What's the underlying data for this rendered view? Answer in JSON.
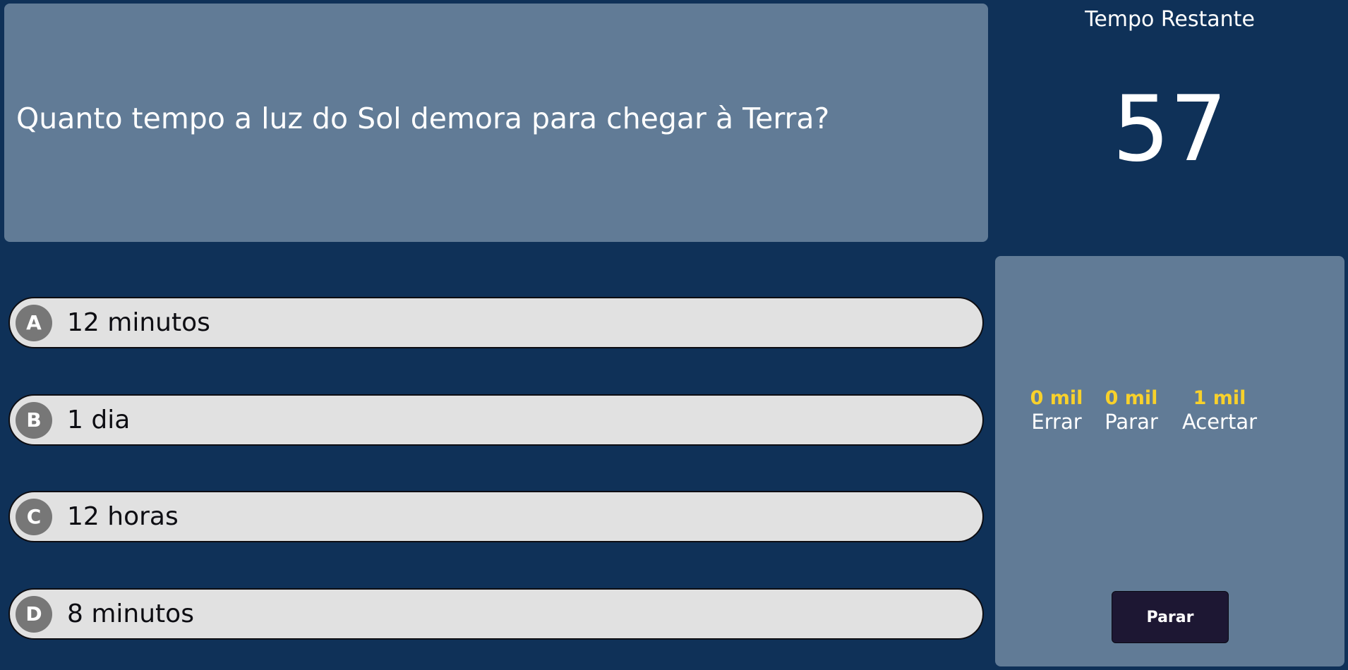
{
  "question": {
    "text": "Quanto tempo a luz do Sol demora para chegar à Terra?"
  },
  "timer": {
    "label": "Tempo Restante",
    "value": "57"
  },
  "answers": [
    {
      "letter": "A",
      "text": "12 minutos"
    },
    {
      "letter": "B",
      "text": "1 dia"
    },
    {
      "letter": "C",
      "text": "12 horas"
    },
    {
      "letter": "D",
      "text": "8 minutos"
    }
  ],
  "prizes": {
    "errar": {
      "amount": "0 mil",
      "label": "Errar"
    },
    "parar": {
      "amount": "0 mil",
      "label": "Parar"
    },
    "acertar": {
      "amount": "1 mil",
      "label": "Acertar"
    }
  },
  "stop_button": {
    "label": "Parar"
  },
  "colors": {
    "background": "#0f3158",
    "panel": "#617b96",
    "answer_bg": "#e1e1e1",
    "letter_badge": "#777777",
    "prize_amount": "#f8d12b",
    "stop_button": "#1d1733"
  }
}
